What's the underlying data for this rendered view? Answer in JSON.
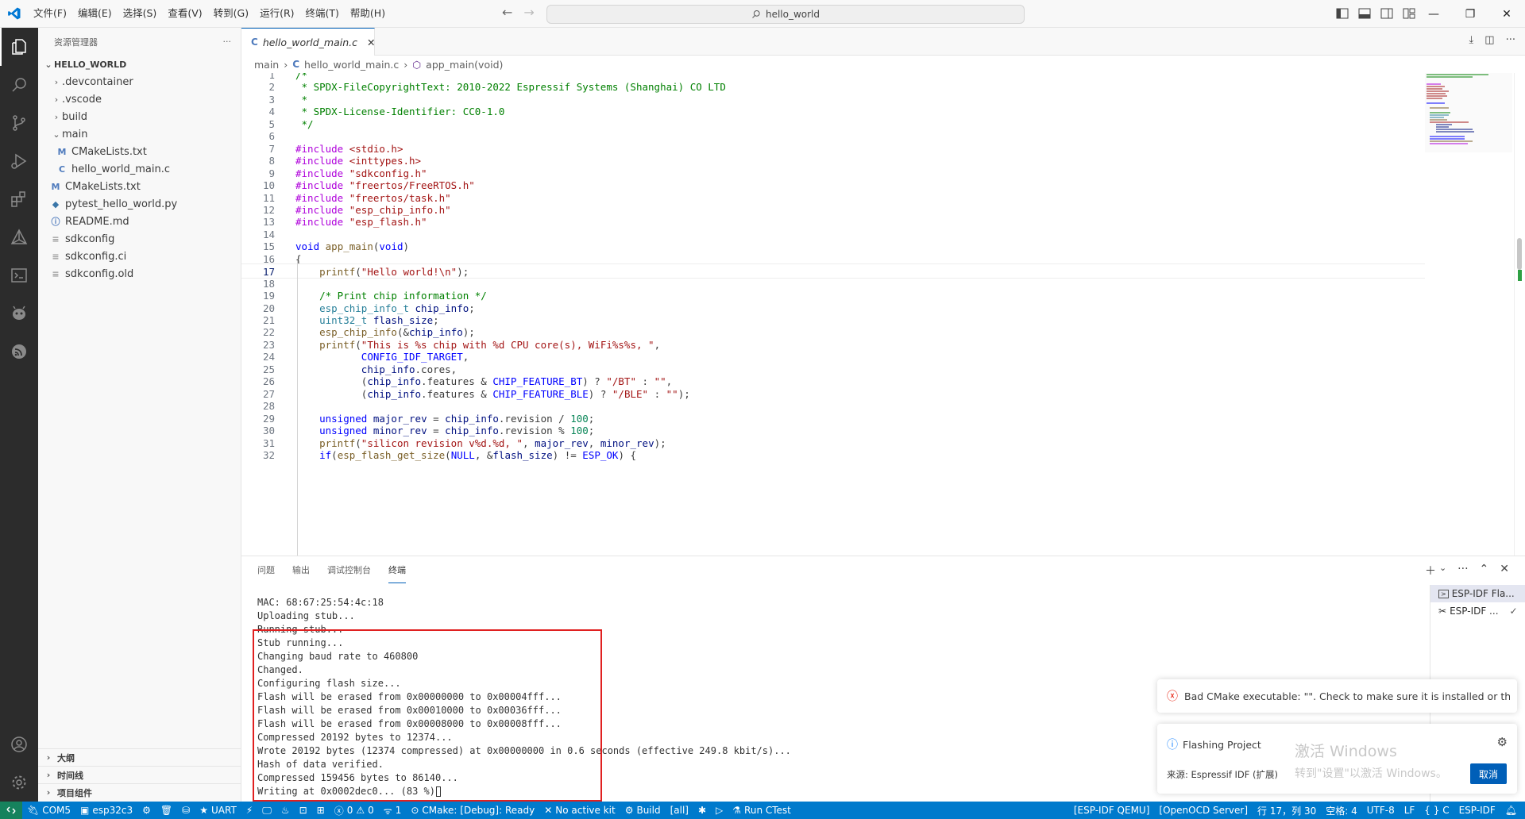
{
  "titlebar": {
    "menus": [
      "文件(F)",
      "编辑(E)",
      "选择(S)",
      "查看(V)",
      "转到(G)",
      "运行(R)",
      "终端(T)",
      "帮助(H)"
    ],
    "search": "hello_world"
  },
  "sidebar": {
    "title": "资源管理器",
    "more": "···",
    "root": "HELLO_WORLD",
    "items": [
      ".devcontainer",
      ".vscode",
      "build",
      "main",
      "CMakeLists.txt",
      "hello_world_main.c",
      "CMakeLists.txt",
      "pytest_hello_world.py",
      "README.md",
      "sdkconfig",
      "sdkconfig.ci",
      "sdkconfig.old"
    ],
    "sections": [
      "大纲",
      "时间线",
      "项目组件"
    ]
  },
  "editor": {
    "tab_label": "hello_world_main.c",
    "breadcrumb": [
      "main",
      "hello_world_main.c",
      "app_main(void)"
    ],
    "line_numbers": [
      "1",
      "2",
      "3",
      "4",
      "5",
      "6",
      "7",
      "8",
      "9",
      "10",
      "11",
      "12",
      "13",
      "14",
      "15",
      "16",
      "17",
      "18",
      "19",
      "20",
      "21",
      "22",
      "23",
      "24",
      "25",
      "26",
      "27",
      "28",
      "29",
      "30",
      "31",
      "32"
    ],
    "lines": [
      "/*",
      " * SPDX-FileCopyrightText: 2010-2022 Espressif Systems (Shanghai) CO LTD",
      " *",
      " * SPDX-License-Identifier: CC0-1.0",
      " */",
      "",
      "#include <stdio.h>",
      "#include <inttypes.h>",
      "#include \"sdkconfig.h\"",
      "#include \"freertos/FreeRTOS.h\"",
      "#include \"freertos/task.h\"",
      "#include \"esp_chip_info.h\"",
      "#include \"esp_flash.h\"",
      "",
      "void app_main(void)",
      "{",
      "    printf(\"Hello world!\\n\");",
      "",
      "    /* Print chip information */",
      "    esp_chip_info_t chip_info;",
      "    uint32_t flash_size;",
      "    esp_chip_info(&chip_info);",
      "    printf(\"This is %s chip with %d CPU core(s), WiFi%s%s, \",",
      "           CONFIG_IDF_TARGET,",
      "           chip_info.cores,",
      "           (chip_info.features & CHIP_FEATURE_BT) ? \"/BT\" : \"\",",
      "           (chip_info.features & CHIP_FEATURE_BLE) ? \"/BLE\" : \"\");",
      "",
      "    unsigned major_rev = chip_info.revision / 100;",
      "    unsigned minor_rev = chip_info.revision % 100;",
      "    printf(\"silicon revision v%d.%d, \", major_rev, minor_rev);",
      "    if(esp_flash_get_size(NULL, &flash_size) != ESP_OK) {"
    ]
  },
  "panel": {
    "tabs": [
      "问题",
      "输出",
      "调试控制台",
      "终端"
    ],
    "terminal_lines": [
      "MAC: 68:67:25:54:4c:18",
      "Uploading stub...",
      "Running stub...",
      "Stub running...",
      "Changing baud rate to 460800",
      "Changed.",
      "Configuring flash size...",
      "Flash will be erased from 0x00000000 to 0x00004fff...",
      "Flash will be erased from 0x00010000 to 0x00036fff...",
      "Flash will be erased from 0x00008000 to 0x00008fff...",
      "Compressed 20192 bytes to 12374...",
      "Wrote 20192 bytes (12374 compressed) at 0x00000000 in 0.6 seconds (effective 249.8 kbit/s)...",
      "Hash of data verified.",
      "Compressed 159456 bytes to 86140...",
      "Writing at 0x0002dec0... (83 %)"
    ],
    "terminal_instances": [
      "ESP-IDF Fla...",
      "ESP-IDF ..."
    ]
  },
  "notifications": {
    "error": "Bad CMake executable: \"\". Check to make sure it is installed or the val...",
    "info_title": "Flashing Project",
    "info_source": "来源: Espressif IDF (扩展)",
    "cancel": "取消",
    "watermark_1": "激活 Windows",
    "watermark_2": "转到\"设置\"以激活 Windows。"
  },
  "statusbar": {
    "port": "COM5",
    "target": "esp32c3",
    "uart": "UART",
    "errors": "0",
    "warnings": "0",
    "ports": "1",
    "cmake": "CMake: [Debug]: Ready",
    "kit": "No active kit",
    "build": "Build",
    "all": "[all]",
    "ctest": "Run CTest",
    "qemu": "[ESP-IDF QEMU]",
    "openocd": "[OpenOCD Server]",
    "position": "行 17，列 30",
    "spaces": "空格: 4",
    "encoding": "UTF-8",
    "eol": "LF",
    "language": "{ } C",
    "idf": "ESP-IDF"
  },
  "colors": {
    "accent": "#007acc",
    "statusbar": "#007acc",
    "highlight_box": "#e02020",
    "cancel_button": "#005fb8"
  }
}
